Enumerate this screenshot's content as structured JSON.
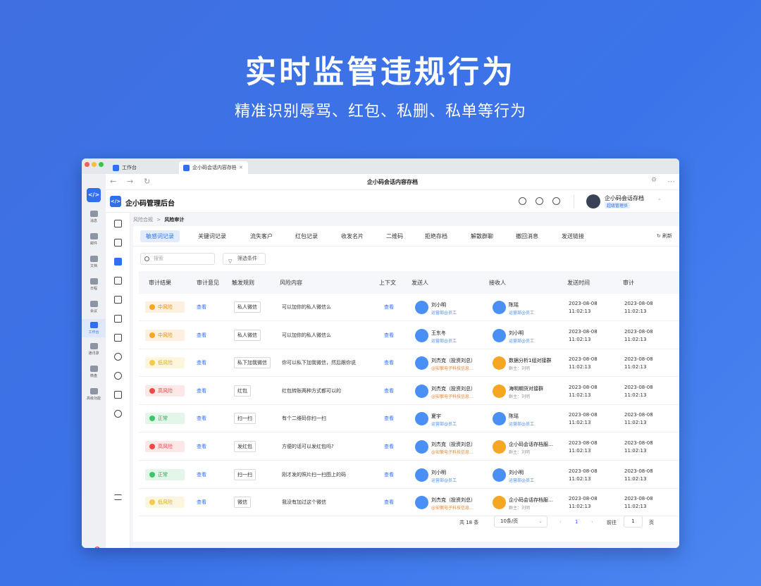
{
  "hero": {
    "title": "实时监管违规行为",
    "subtitle": "精准识别辱骂、红包、私删、私单等行为"
  },
  "browser": {
    "tabs": [
      {
        "label": "工作台",
        "active": false
      },
      {
        "label": "企小码会话内容存档",
        "active": true
      }
    ],
    "address_title": "企小码会话内容存档"
  },
  "left_sidebar": {
    "items": [
      {
        "label": "消息",
        "icon": "chat-icon"
      },
      {
        "label": "邮件",
        "icon": "mail-icon"
      },
      {
        "label": "文档",
        "icon": "doc-icon"
      },
      {
        "label": "日程",
        "icon": "calendar-icon"
      },
      {
        "label": "会议",
        "icon": "meeting-icon"
      },
      {
        "label": "工作台",
        "icon": "grid-icon",
        "active": true
      },
      {
        "label": "通讯录",
        "icon": "contacts-icon"
      },
      {
        "label": "微盘",
        "icon": "drive-icon"
      },
      {
        "label": "高级功能",
        "icon": "advanced-icon"
      }
    ],
    "notification_count": "1"
  },
  "app": {
    "logo": "</>",
    "title": "企小码管理后台",
    "user_name": "企小码会话存档",
    "user_role": "超级管理员"
  },
  "breadcrumb": {
    "parent": "风险合规",
    "separator": ">",
    "current": "风险审计"
  },
  "tabs": [
    {
      "label": "敏感词记录",
      "active": true
    },
    {
      "label": "关键词记录"
    },
    {
      "label": "流失客户"
    },
    {
      "label": "红包记录"
    },
    {
      "label": "收发名片"
    },
    {
      "label": "二维码"
    },
    {
      "label": "拒绝存档"
    },
    {
      "label": "解散群聊"
    },
    {
      "label": "撤回消息"
    },
    {
      "label": "发送链接"
    }
  ],
  "refresh_label": "刷新",
  "search": {
    "placeholder": "搜索"
  },
  "filter_label": "筛选条件",
  "table": {
    "headers": [
      "审计结果",
      "审计意见",
      "触发规则",
      "风险内容",
      "上下文",
      "发送人",
      "接收人",
      "发送时间",
      "审计"
    ],
    "rows": [
      {
        "result": "中风险",
        "level": "mid",
        "opinion": "查看",
        "rule": "私人微信",
        "content": "可以加你的私人微信么",
        "context": "查看",
        "sender": {
          "name": "刘小明",
          "sub": "运营部@员工",
          "type": "employee"
        },
        "receiver": {
          "name": "陈瑶",
          "sub": "运营部@员工",
          "type": "employee"
        },
        "time_date": "2023-08-08",
        "time_clock": "11:02:13",
        "audit_date": "2023-08-08",
        "audit_clock": "11:02:13"
      },
      {
        "result": "中风险",
        "level": "mid",
        "opinion": "查看",
        "rule": "私人微信",
        "content": "可以加你的私人微信么",
        "context": "查看",
        "sender": {
          "name": "王东冬",
          "sub": "运营部@员工",
          "type": "employee"
        },
        "receiver": {
          "name": "刘小明",
          "sub": "运营部@员工",
          "type": "employee"
        },
        "time_date": "2023-08-08",
        "time_clock": "11:02:13",
        "audit_date": "2023-08-08",
        "audit_clock": "11:02:13"
      },
      {
        "result": "低风险",
        "level": "low",
        "opinion": "查看",
        "rule": "私下加我微信",
        "content": "你可以私下加我微信，然后跟你说",
        "context": "查看",
        "sender": {
          "name": "刘杰克（投资刘总）",
          "sub": "@安徽电子科技信息…",
          "type": "customer"
        },
        "receiver": {
          "name": "数据分析1组对接群",
          "sub": "群主：刘明",
          "type": "group"
        },
        "time_date": "2023-08-08",
        "time_clock": "11:02:13",
        "audit_date": "2023-08-08",
        "audit_clock": "11:02:13"
      },
      {
        "result": "高风险",
        "level": "high",
        "opinion": "查看",
        "rule": "红包",
        "content": "红包转账两种方式都可以的",
        "context": "查看",
        "sender": {
          "name": "刘杰克（投资刘总）",
          "sub": "@安徽电子科技信息…",
          "type": "customer"
        },
        "receiver": {
          "name": "海明期货对接群",
          "sub": "群主：刘明",
          "type": "group"
        },
        "time_date": "2023-08-08",
        "time_clock": "11:02:13",
        "audit_date": "2023-08-08",
        "audit_clock": "11:02:13"
      },
      {
        "result": "正常",
        "level": "normal",
        "opinion": "查看",
        "rule": "扫一扫",
        "content": "有个二维码你扫一扫",
        "context": "查看",
        "sender": {
          "name": "夏宇",
          "sub": "运营部@员工",
          "type": "employee"
        },
        "receiver": {
          "name": "陈瑶",
          "sub": "运营部@员工",
          "type": "employee"
        },
        "time_date": "2023-08-08",
        "time_clock": "11:02:13",
        "audit_date": "2023-08-08",
        "audit_clock": "11:02:13"
      },
      {
        "result": "高风险",
        "level": "high",
        "opinion": "查看",
        "rule": "发红包",
        "content": "方便的话可以发红包吗?",
        "context": "查看",
        "sender": {
          "name": "刘杰克（投资刘总）",
          "sub": "@安徽电子科技信息…",
          "type": "customer"
        },
        "receiver": {
          "name": "企小码会话存档服…",
          "sub": "群主：刘明",
          "type": "group"
        },
        "time_date": "2023-08-08",
        "time_clock": "11:02:13",
        "audit_date": "2023-08-08",
        "audit_clock": "11:02:13"
      },
      {
        "result": "正常",
        "level": "normal",
        "opinion": "查看",
        "rule": "扫一扫",
        "content": "刚才发的照片扫一扫图上的码",
        "context": "查看",
        "sender": {
          "name": "刘小明",
          "sub": "运营部@员工",
          "type": "employee"
        },
        "receiver": {
          "name": "刘小明",
          "sub": "运营部@员工",
          "type": "employee"
        },
        "time_date": "2023-08-08",
        "time_clock": "11:02:13",
        "audit_date": "2023-08-08",
        "audit_clock": "11:02:13"
      },
      {
        "result": "低风险",
        "level": "low",
        "opinion": "查看",
        "rule": "微信",
        "content": "我没有加过这个微信",
        "context": "查看",
        "sender": {
          "name": "刘杰克（投资刘总）",
          "sub": "@安徽电子科技信息…",
          "type": "customer"
        },
        "receiver": {
          "name": "企小码会话存档服…",
          "sub": "群主：刘明",
          "type": "group"
        },
        "time_date": "2023-08-08",
        "time_clock": "11:02:13",
        "audit_date": "2023-08-08",
        "audit_clock": "11:02:13"
      }
    ]
  },
  "pagination": {
    "total": "共 18 条",
    "page_size": "10条/页",
    "current_page": "1",
    "goto_label": "前往",
    "goto_value": "1",
    "page_unit": "页"
  },
  "colors": {
    "accent": "#2f6ff0",
    "high": "#f04848",
    "mid": "#f5a623",
    "low": "#f7c948",
    "normal": "#3cc56a"
  }
}
